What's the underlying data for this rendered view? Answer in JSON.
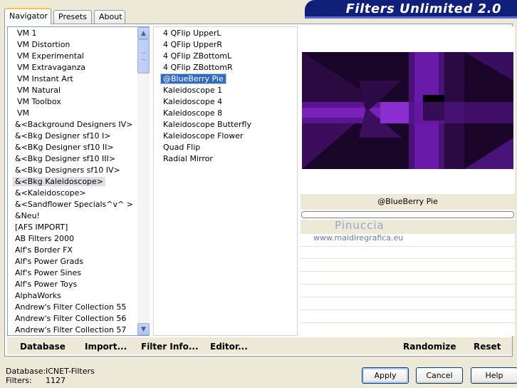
{
  "tabs": [
    {
      "label": "Navigator",
      "active": true
    },
    {
      "label": "Presets",
      "active": false
    },
    {
      "label": "About",
      "active": false
    }
  ],
  "title": "Filters Unlimited 2.0",
  "categories": [
    "VM 1",
    "VM Distortion",
    "VM Experimental",
    "VM Extravaganza",
    "VM Instant Art",
    "VM Natural",
    "VM Toolbox",
    "VM",
    "&<Background Designers IV>",
    "&<Bkg Designer sf10 I>",
    "&<BKg Designer sf10 II>",
    "&<Bkg Designer sf10 III>",
    "&<Bkg Designers sf10 IV>",
    "&<Bkg Kaleidoscope>",
    "&<Kaleidoscope>",
    "&<Sandflower Specials^v^ >",
    "&Neu!",
    "[AFS IMPORT]",
    "AB Filters 2000",
    "Alf's Border FX",
    "Alf's Power Grads",
    "Alf's Power Sines",
    "Alf's Power Toys",
    "AlphaWorks",
    "Andrew's Filter Collection 55",
    "Andrew's Filter Collection 56",
    "Andrew's Filter Collection 57"
  ],
  "selected_category": "&<Bkg Kaleidoscope>",
  "filters": [
    "4 QFlip UpperL",
    "4 QFlip UpperR",
    "4 QFlip ZBottomL",
    "4 QFlip ZBottomR",
    "@BlueBerry Pie",
    "Kaleidoscope 1",
    "Kaleidoscope 4",
    "Kaleidoscope 8",
    "Kaleidoscope Butterfly",
    "Kaleidoscope Flower",
    "Quad Flip",
    "Radial Mirror"
  ],
  "selected_filter": "@BlueBerry Pie",
  "preview": {
    "filter_name": "@BlueBerry Pie"
  },
  "watermark": {
    "name": "Pinuccia",
    "url": "www.maidiregrafica.eu"
  },
  "bottom_buttons": {
    "database": "Database",
    "import": "Import...",
    "filter_info": "Filter Info...",
    "editor": "Editor...",
    "randomize": "Randomize",
    "reset": "Reset"
  },
  "footer": {
    "database_label": "Database:",
    "database_value": "ICNET-Filters",
    "filters_label": "Filters:",
    "filters_value": "1127"
  },
  "dialog_buttons": {
    "apply": "Apply",
    "cancel": "Cancel",
    "help": "Help"
  },
  "colors": {
    "banner": "#10207a",
    "selection": "#316ac5",
    "preview_purple": "#6a1a9a",
    "preview_bright": "#8c2fd0"
  },
  "icons": {
    "scroll_up": "chevron-up-icon",
    "scroll_down": "chevron-down-icon"
  }
}
